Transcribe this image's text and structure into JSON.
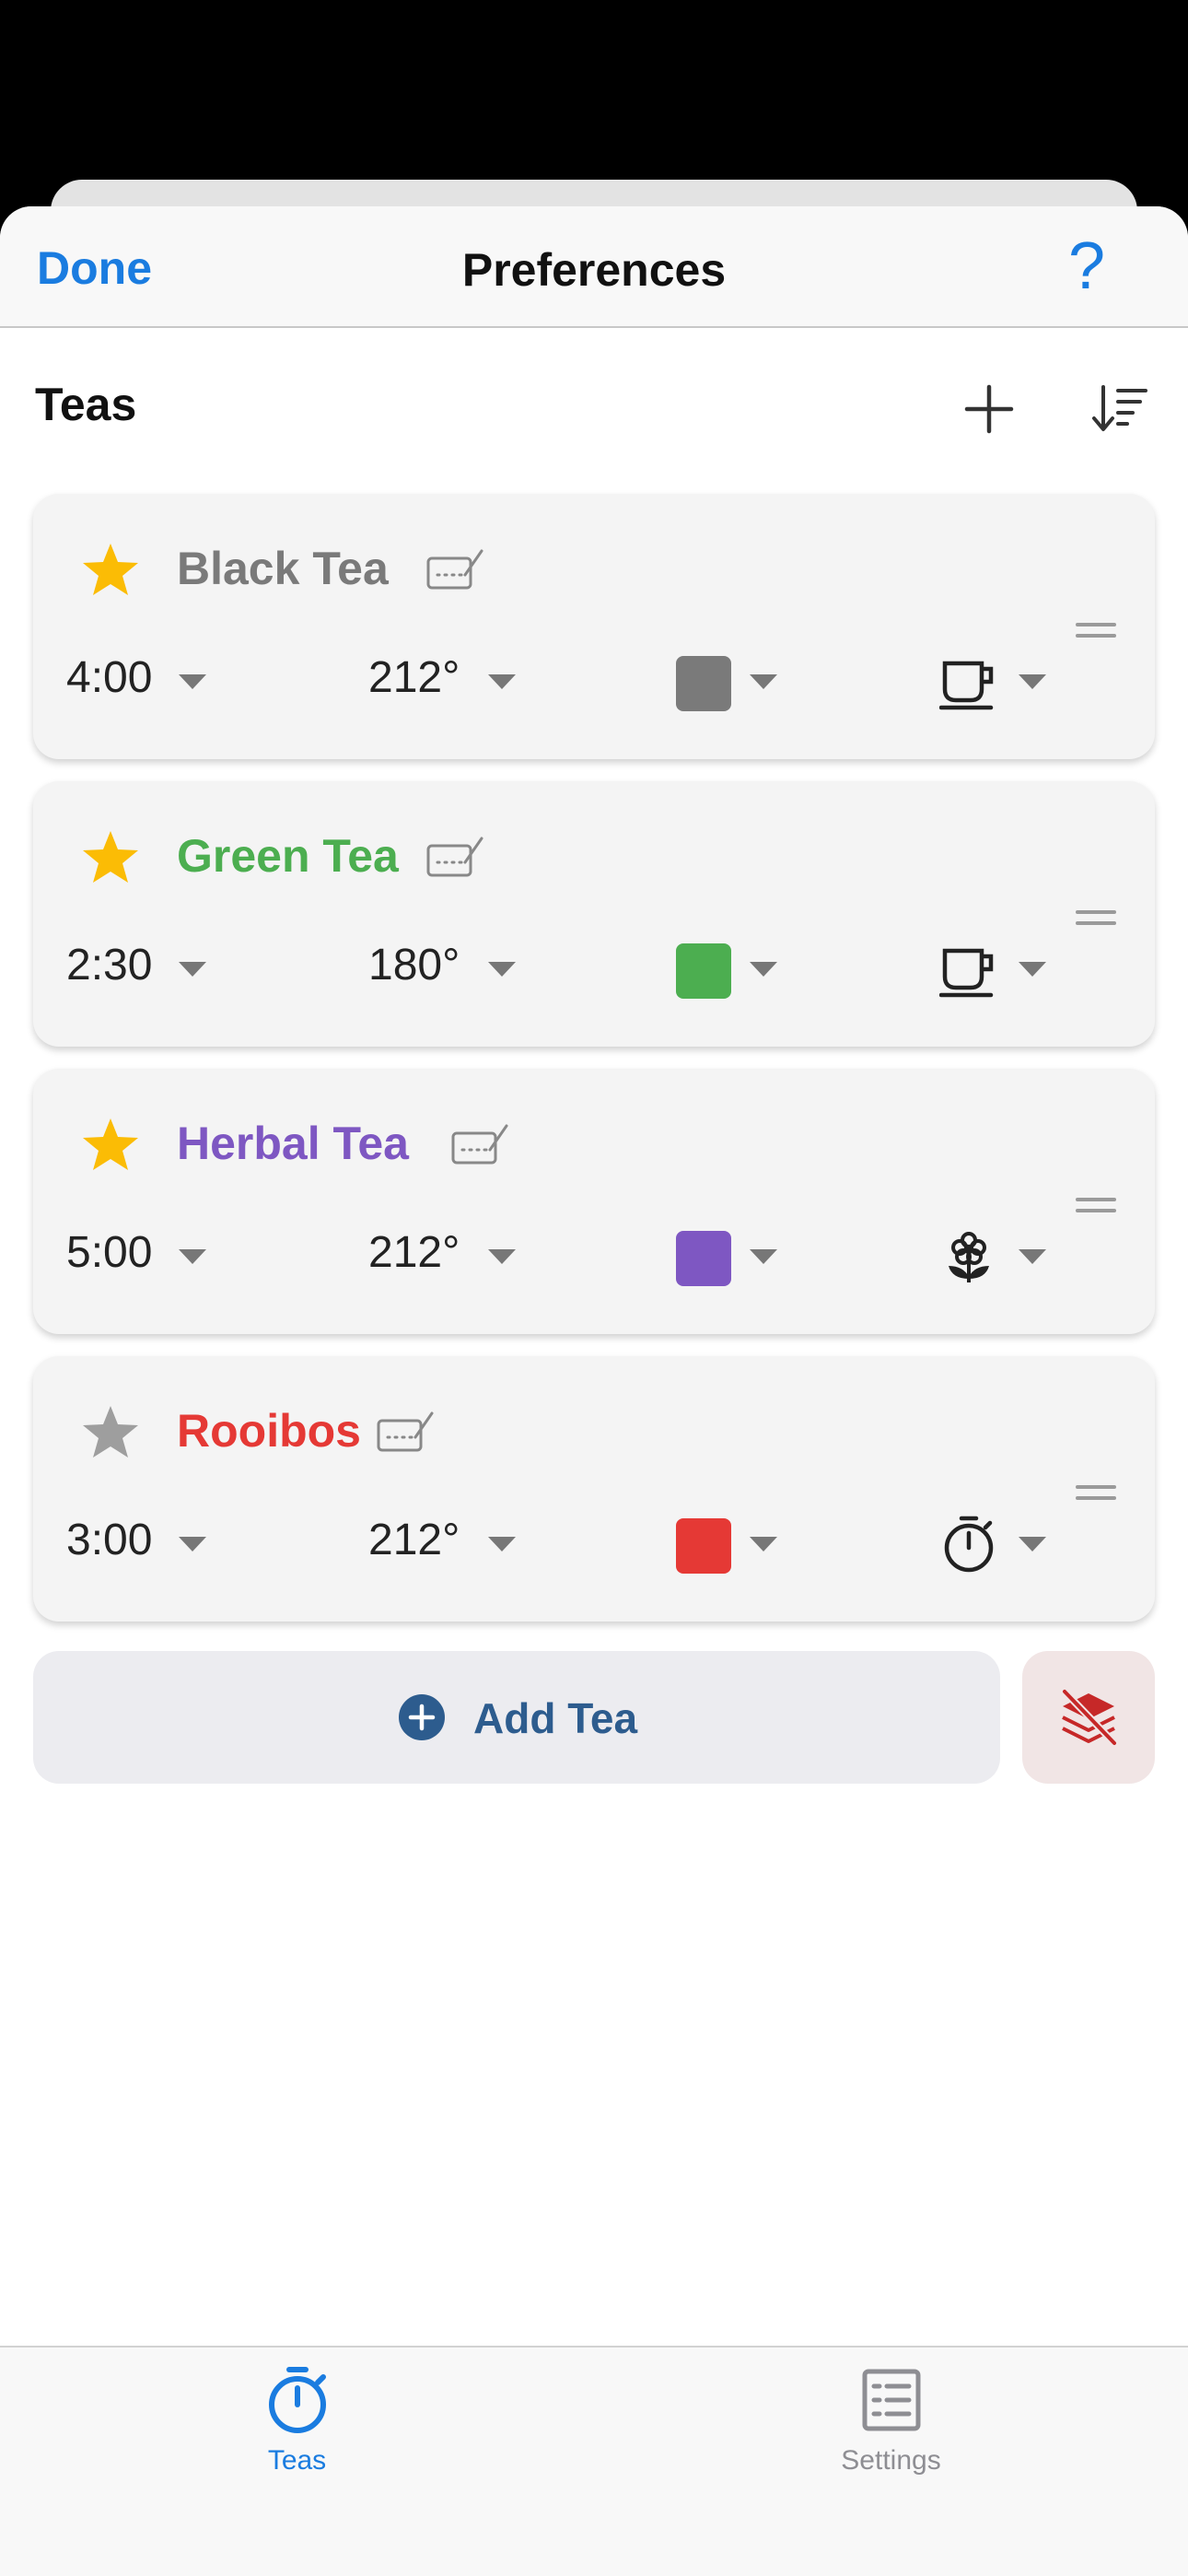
{
  "nav": {
    "done": "Done",
    "title": "Preferences",
    "help": "?"
  },
  "section": {
    "title": "Teas"
  },
  "teas": [
    {
      "name": "Black Tea",
      "favorite": true,
      "time": "4:00",
      "temp": "212°",
      "color": "#7a7a7a",
      "type_icon": "cup-icon"
    },
    {
      "name": "Green Tea",
      "favorite": true,
      "time": "2:30",
      "temp": "180°",
      "color": "#4cae50",
      "type_icon": "cup-icon"
    },
    {
      "name": "Herbal Tea",
      "favorite": true,
      "time": "5:00",
      "temp": "212°",
      "color": "#7e57c2",
      "type_icon": "flower-icon"
    },
    {
      "name": "Rooibos",
      "favorite": false,
      "time": "3:00",
      "temp": "212°",
      "color": "#e53935",
      "type_icon": "timer-icon"
    }
  ],
  "add_button": {
    "label": "Add Tea"
  },
  "tabs": [
    {
      "label": "Teas",
      "icon": "timer-icon",
      "selected": true
    },
    {
      "label": "Settings",
      "icon": "list-icon",
      "selected": false
    }
  ],
  "colors": {
    "accent": "#1a7ce0",
    "star_active": "#fbbc05",
    "star_inactive": "#9e9e9e",
    "add_button_text": "#2d5c8e",
    "stack_icon": "#c62828",
    "tab_inactive": "#8e8e93"
  }
}
